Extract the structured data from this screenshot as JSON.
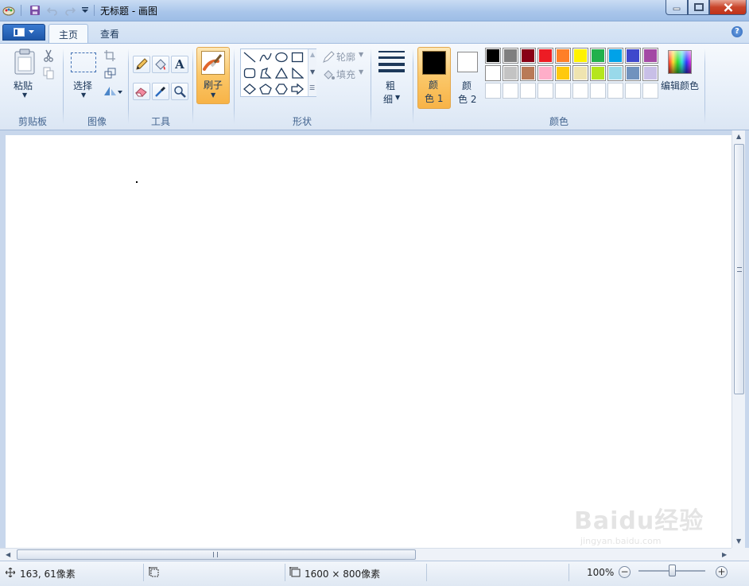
{
  "window": {
    "title": "无标题 - 画图"
  },
  "tabs": [
    {
      "label": "主页"
    },
    {
      "label": "查看"
    }
  ],
  "groups": {
    "clipboard": {
      "label": "剪贴板",
      "paste": "粘贴"
    },
    "image": {
      "label": "图像",
      "select": "选择"
    },
    "tools": {
      "label": "工具"
    },
    "brushes": {
      "label": "刷子"
    },
    "shapes": {
      "label": "形状",
      "outline": "轮廓",
      "fill": "填充"
    },
    "size": {
      "label_top": "粗",
      "label_bottom": "细"
    },
    "colors": {
      "label": "颜色",
      "color1_top": "颜",
      "color1_bottom": "色 1",
      "color2_top": "颜",
      "color2_bottom": "色 2",
      "edit": "编辑颜色",
      "color1_value": "#000000",
      "color2_value": "#ffffff"
    }
  },
  "palette": {
    "row1": [
      "#000000",
      "#7f7f7f",
      "#880015",
      "#ed1c24",
      "#ff7f27",
      "#fff200",
      "#22b14c",
      "#00a2e8",
      "#3f48cc",
      "#a349a4"
    ],
    "row2": [
      "#ffffff",
      "#c3c3c3",
      "#b97a57",
      "#ffaec9",
      "#ffc90e",
      "#efe4b0",
      "#b5e61d",
      "#99d9ea",
      "#7092be",
      "#c8bfe7"
    ],
    "row3_empty_count": 10
  },
  "status": {
    "cursor_pos": "163, 61像素",
    "selection_size": "",
    "canvas_size": "1600 × 800像素",
    "zoom": "100%"
  },
  "zoom_level_fraction": 0.5,
  "watermark": {
    "text": "Baidu经验",
    "sub": "jingyan.baidu.com"
  }
}
